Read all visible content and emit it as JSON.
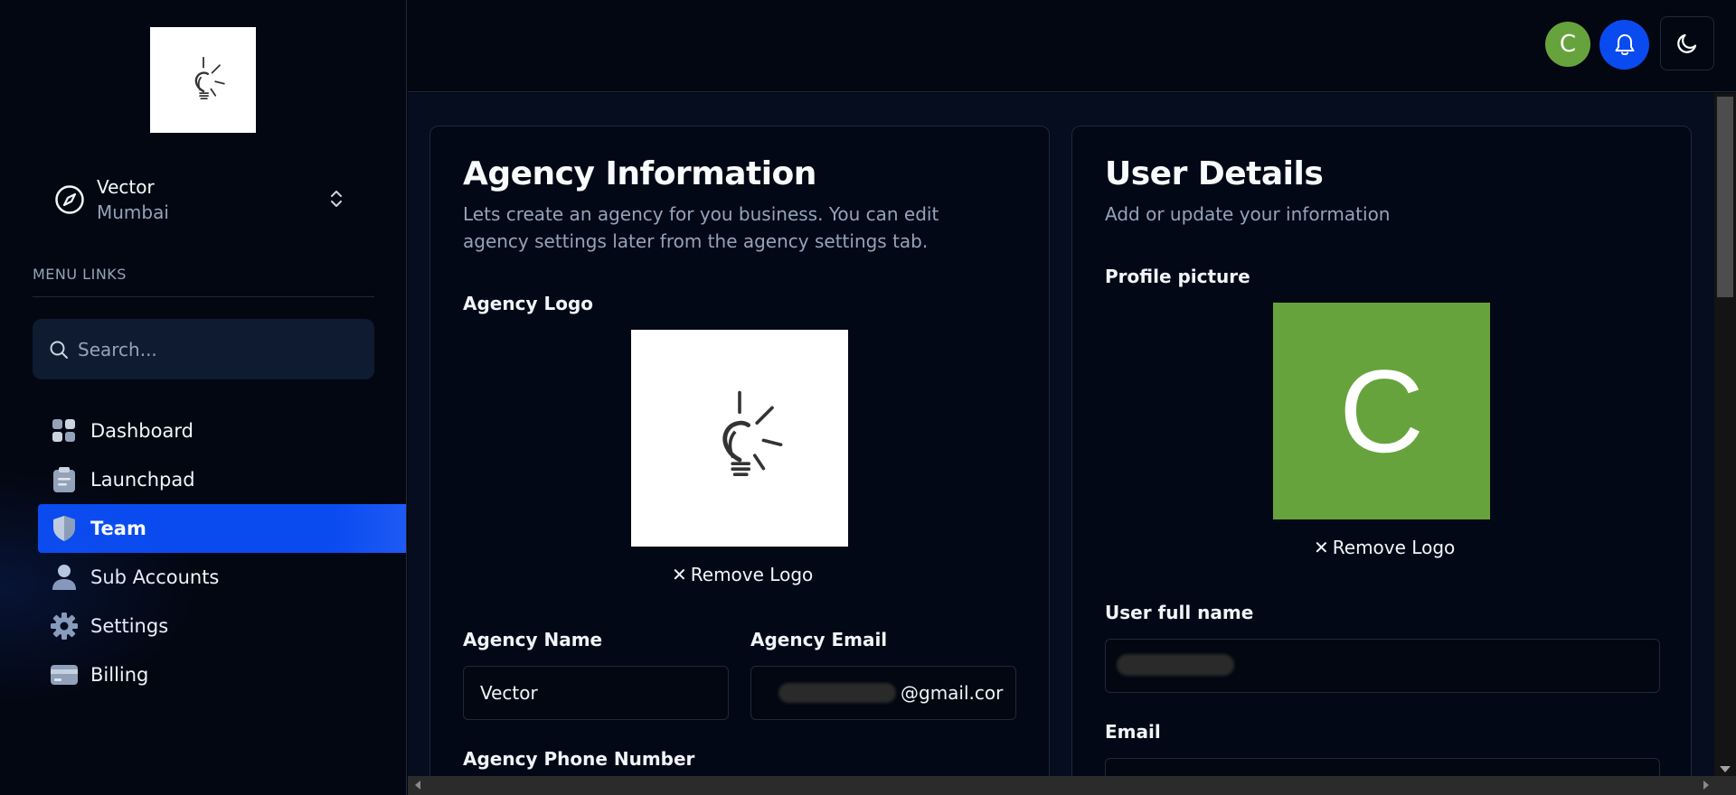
{
  "sidebar": {
    "account": {
      "name": "Vector",
      "location": "Mumbai"
    },
    "menu_title": "MENU LINKS",
    "search_placeholder": "Search...",
    "items": [
      {
        "label": "Dashboard",
        "icon": "dashboard-icon",
        "active": false
      },
      {
        "label": "Launchpad",
        "icon": "clipboard-icon",
        "active": false
      },
      {
        "label": "Team",
        "icon": "shield-icon",
        "active": true
      },
      {
        "label": "Sub Accounts",
        "icon": "person-icon",
        "active": false
      },
      {
        "label": "Settings",
        "icon": "gear-icon",
        "active": false
      },
      {
        "label": "Billing",
        "icon": "credit-card-icon",
        "active": false
      }
    ]
  },
  "topbar": {
    "avatar_initial": "C",
    "avatar_color": "#67a33d",
    "bell_color": "#0a4bf0"
  },
  "agency": {
    "title": "Agency Information",
    "description": "Lets create an agency for you business. You can edit agency settings later from the agency settings tab.",
    "logo_label": "Agency Logo",
    "remove_logo": "Remove Logo",
    "name_label": "Agency Name",
    "name_value": "Vector",
    "email_label": "Agency Email",
    "email_visible": "@gmail.cor",
    "phone_label": "Agency Phone Number"
  },
  "user": {
    "title": "User Details",
    "description": "Add or update your information",
    "picture_label": "Profile picture",
    "picture_initial": "C",
    "remove_logo": "Remove Logo",
    "fullname_label": "User full name",
    "email_label": "Email"
  },
  "colors": {
    "accent": "#0a4bf0",
    "background": "#030712",
    "avatar_green": "#67a33d"
  }
}
